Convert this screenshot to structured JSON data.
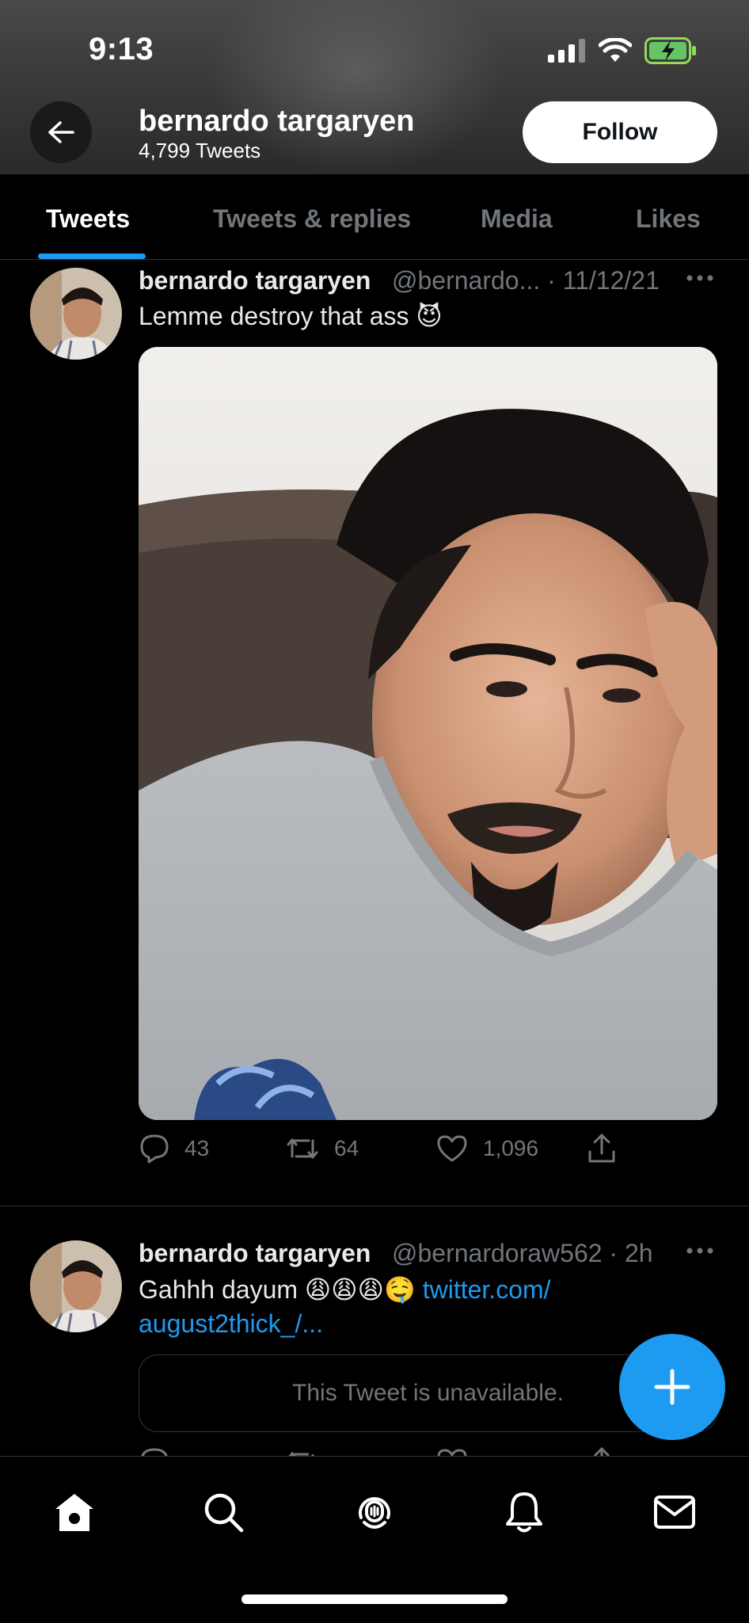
{
  "status_bar": {
    "time": "9:13"
  },
  "header": {
    "name": "bernardo targaryen",
    "tweet_count": "4,799 Tweets",
    "follow_label": "Follow"
  },
  "tabs": [
    {
      "label": "Tweets",
      "active": true
    },
    {
      "label": "Tweets & replies",
      "active": false
    },
    {
      "label": "Media",
      "active": false
    },
    {
      "label": "Likes",
      "active": false
    }
  ],
  "tweets": [
    {
      "name": "bernardo targaryen",
      "meta": "@bernardo... · 11/12/21",
      "text": "Lemme destroy that ass 😈",
      "replies": "43",
      "retweets": "64",
      "likes": "1,096"
    },
    {
      "name": "bernardo targaryen",
      "meta": "@bernardoraw562 · 2h",
      "text": "Gahhh dayum 😩😩😩🤤",
      "link_line1": "twitter.com/",
      "link_line2": "august2thick_/...",
      "quote_unavailable": "This Tweet is unavailable."
    }
  ],
  "icons": {
    "back": "arrow-left-icon",
    "more": "more-icon",
    "reply": "reply-icon",
    "retweet": "retweet-icon",
    "like": "heart-icon",
    "share": "share-icon",
    "compose": "plus-icon",
    "nav": [
      "home-icon",
      "search-icon",
      "spaces-icon",
      "bell-icon",
      "mail-icon"
    ]
  },
  "colors": {
    "accent": "#1d9bf0",
    "muted": "#71767b",
    "background": "#000000"
  }
}
